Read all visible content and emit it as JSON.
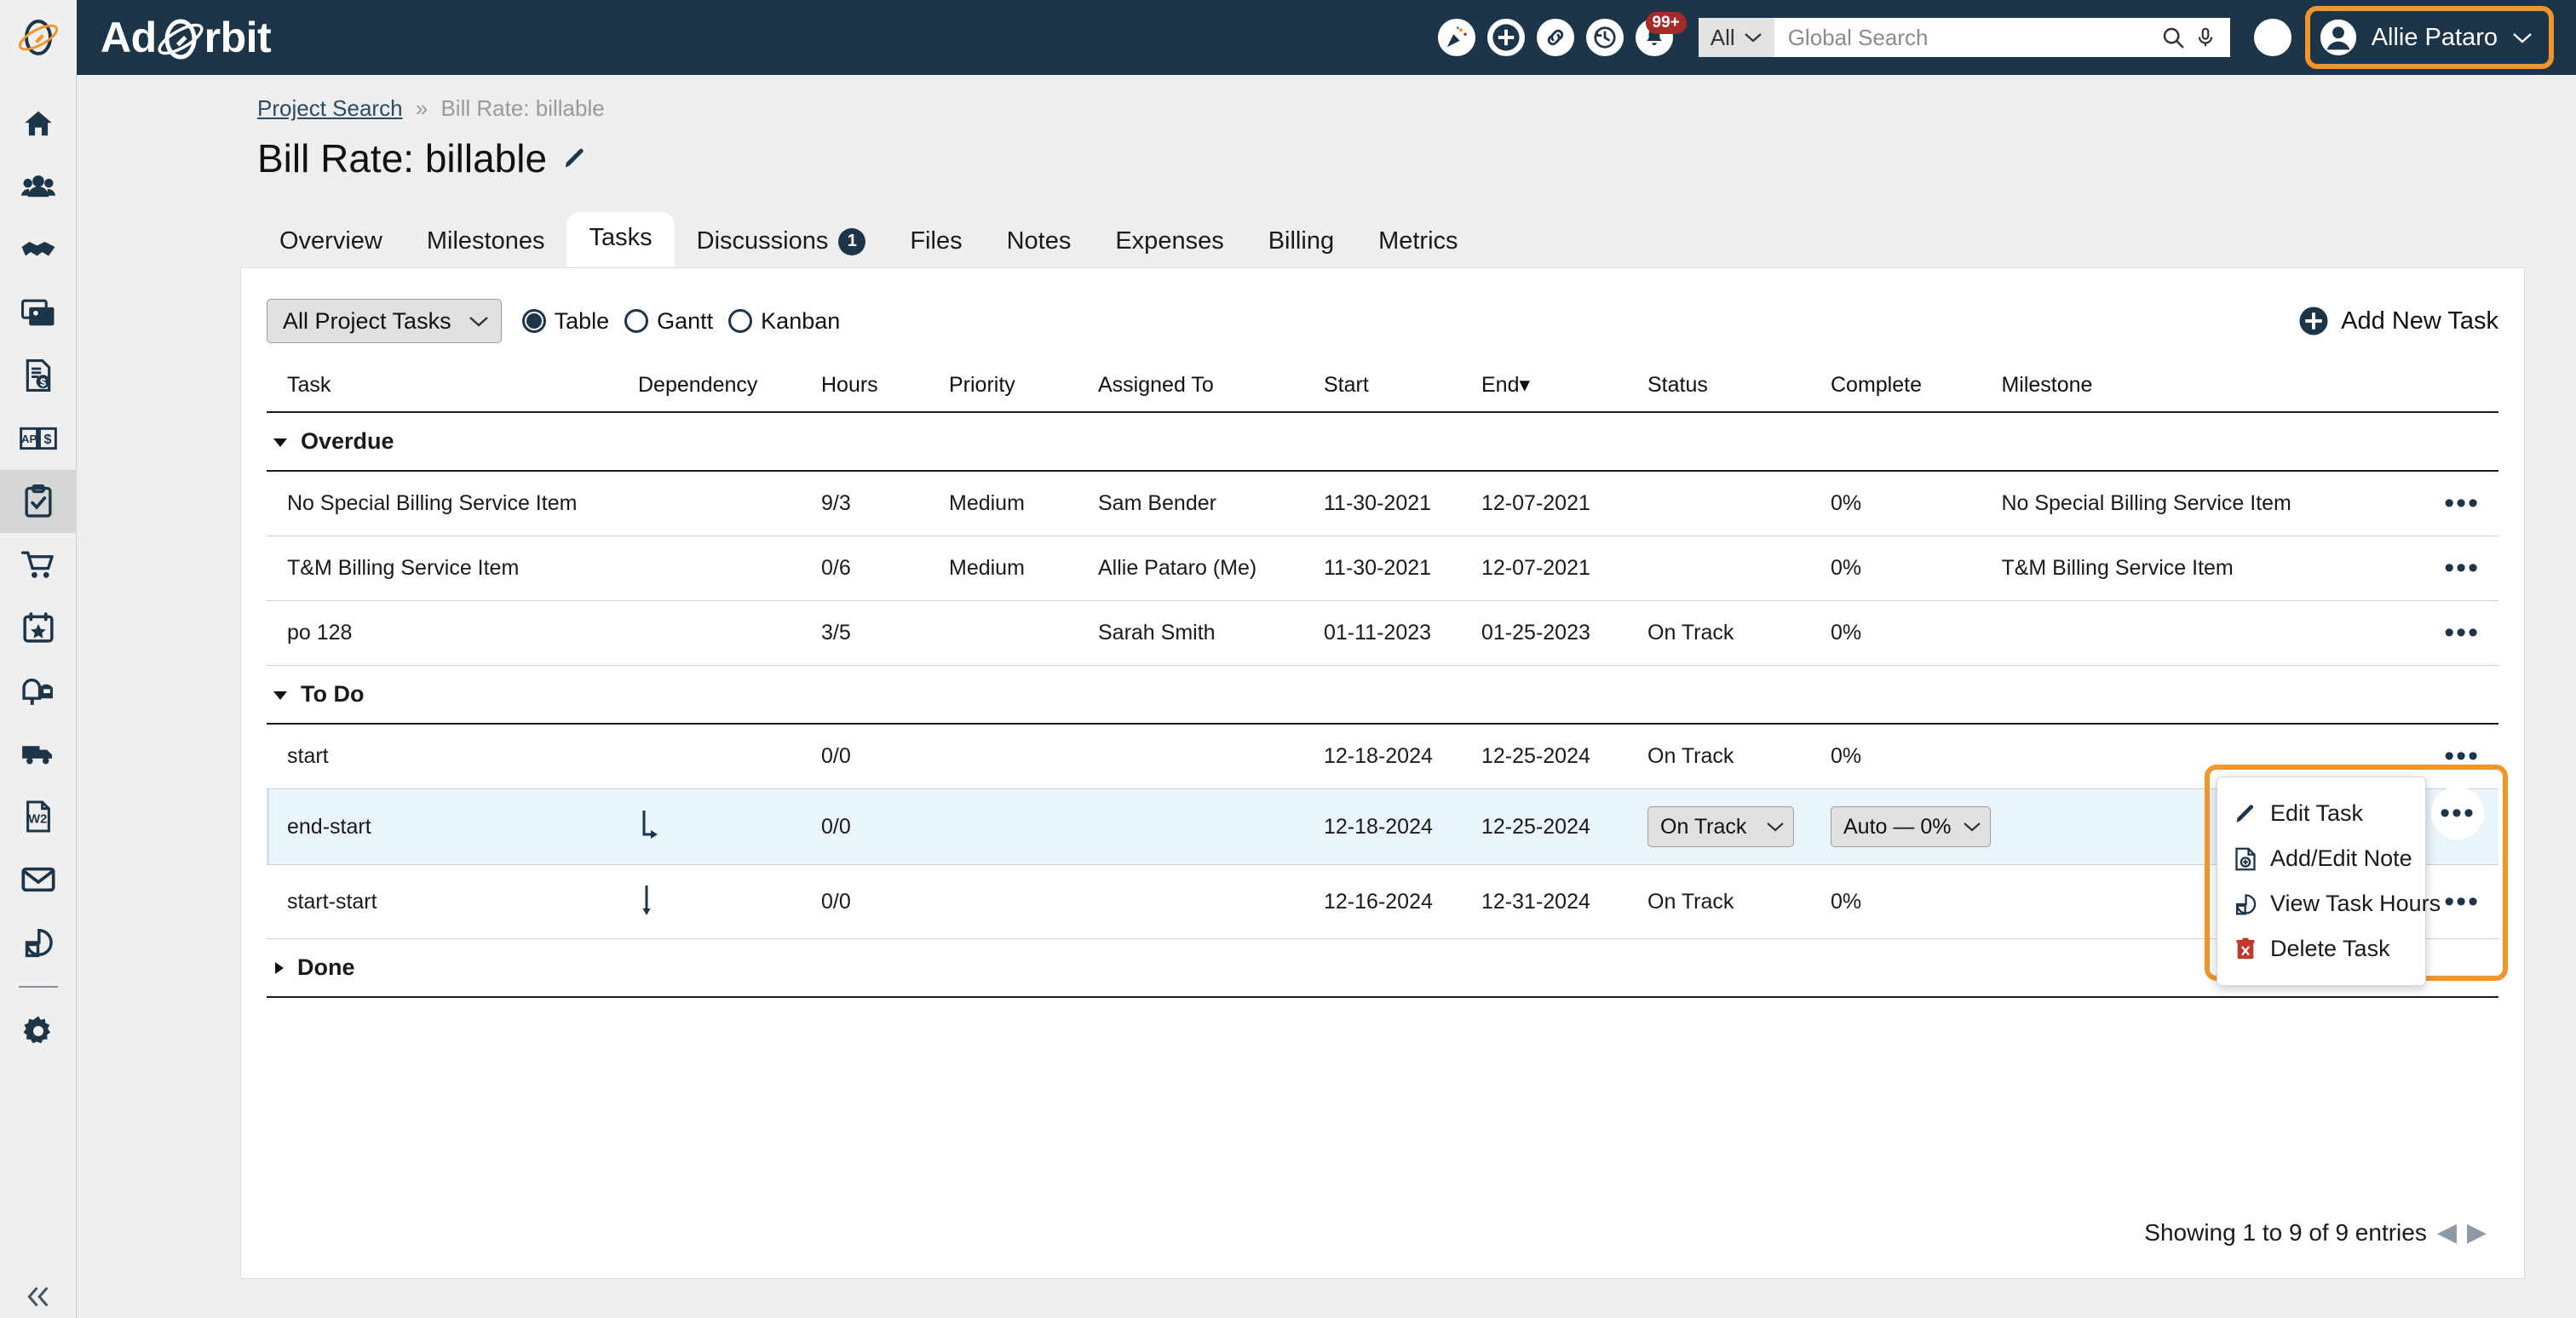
{
  "header": {
    "brand": "AdOrbit",
    "brand_parts": {
      "pre": "Ad",
      "post": "rbit"
    },
    "icons": [
      {
        "name": "celebration-icon",
        "glyph": "🎉"
      },
      {
        "name": "add-icon",
        "glyph": "+"
      },
      {
        "name": "link-icon",
        "glyph": "🔗"
      },
      {
        "name": "history-icon",
        "glyph": "↺"
      },
      {
        "name": "notifications-bell-icon",
        "glyph": "🔔"
      }
    ],
    "notification_badge": "99+",
    "search_scope": "All",
    "search_placeholder": "Global Search",
    "search_value": "",
    "help_label": "?",
    "user_name": "Allie Pataro",
    "accent_orange": "#f0962c",
    "navy": "#1d3549",
    "badge_red": "#a62a2a"
  },
  "sidebar": {
    "items": [
      {
        "name": "home",
        "label": "Home"
      },
      {
        "name": "people",
        "label": "People"
      },
      {
        "name": "partners",
        "label": "Partners"
      },
      {
        "name": "media",
        "label": "Media"
      },
      {
        "name": "invoices",
        "label": "Invoices"
      },
      {
        "name": "ap-ar",
        "label": "AP/AR"
      },
      {
        "name": "projects",
        "label": "Projects",
        "active": true
      },
      {
        "name": "orders",
        "label": "Orders"
      },
      {
        "name": "events",
        "label": "Events"
      },
      {
        "name": "mailbox",
        "label": "Mailbox"
      },
      {
        "name": "shipping",
        "label": "Shipping"
      },
      {
        "name": "w2",
        "label": "W2"
      },
      {
        "name": "email",
        "label": "Email"
      },
      {
        "name": "reports",
        "label": "Reports"
      },
      {
        "name": "settings",
        "label": "Settings"
      }
    ],
    "collapse_label": "Collapse"
  },
  "breadcrumb": {
    "root": "Project Search",
    "separator": "»",
    "current": "Bill Rate: billable"
  },
  "page": {
    "title": "Bill Rate: billable"
  },
  "tabs": [
    {
      "label": "Overview",
      "active": false
    },
    {
      "label": "Milestones",
      "active": false
    },
    {
      "label": "Tasks",
      "active": true
    },
    {
      "label": "Discussions",
      "badge": "1",
      "active": false
    },
    {
      "label": "Files",
      "active": false
    },
    {
      "label": "Notes",
      "active": false
    },
    {
      "label": "Expenses",
      "active": false
    },
    {
      "label": "Billing",
      "active": false
    },
    {
      "label": "Metrics",
      "active": false
    }
  ],
  "toolbar": {
    "filter_value": "All Project Tasks",
    "views": [
      {
        "label": "Table",
        "selected": true
      },
      {
        "label": "Gantt",
        "selected": false
      },
      {
        "label": "Kanban",
        "selected": false
      }
    ],
    "add_task_label": "Add New Task"
  },
  "table": {
    "columns": [
      "Task",
      "Dependency",
      "Hours",
      "Priority",
      "Assigned To",
      "Start",
      "End",
      "Status",
      "Complete",
      "Milestone"
    ],
    "sorted_column": "End",
    "sort_indicator": "▾",
    "groups": [
      {
        "label": "Overdue",
        "expanded": true,
        "rows": [
          {
            "task": "No Special Billing Service Item",
            "dependency": "",
            "hours": "9/3",
            "priority": "Medium",
            "assigned_to": "Sam Bender",
            "start": "11-30-2021",
            "end": "12-07-2021",
            "status": "",
            "complete": "0%",
            "milestone": "No Special Billing Service Item"
          },
          {
            "task": "T&M Billing Service Item",
            "dependency": "",
            "hours": "0/6",
            "priority": "Medium",
            "assigned_to": "Allie Pataro (Me)",
            "start": "11-30-2021",
            "end": "12-07-2021",
            "status": "",
            "complete": "0%",
            "milestone": "T&M Billing Service Item"
          },
          {
            "task": "po 128",
            "dependency": "",
            "hours": "3/5",
            "priority": "",
            "assigned_to": "Sarah Smith",
            "start": "01-11-2023",
            "end": "01-25-2023",
            "status": "On Track",
            "complete": "0%",
            "milestone": ""
          }
        ]
      },
      {
        "label": "To Do",
        "expanded": true,
        "rows": [
          {
            "task": "start",
            "dependency": "",
            "hours": "0/0",
            "priority": "",
            "assigned_to": "",
            "start": "12-18-2024",
            "end": "12-25-2024",
            "status": "On Track",
            "complete": "0%",
            "milestone": ""
          },
          {
            "task": "end-start",
            "dependency": "end-start-arrow",
            "hours": "0/0",
            "priority": "",
            "assigned_to": "",
            "start": "12-18-2024",
            "end": "12-25-2024",
            "status_select": "On Track",
            "complete_select": "Auto — 0%",
            "milestone": "",
            "highlighted": true
          },
          {
            "task": "start-start",
            "dependency": "start-start-arrow",
            "hours": "0/0",
            "priority": "",
            "assigned_to": "",
            "start": "12-16-2024",
            "end": "12-31-2024",
            "status": "On Track",
            "complete": "0%",
            "milestone": ""
          }
        ]
      },
      {
        "label": "Done",
        "expanded": false,
        "rows": []
      }
    ]
  },
  "context_menu": {
    "items": [
      {
        "label": "Edit Task",
        "icon": "pencil-icon"
      },
      {
        "label": "Add/Edit Note",
        "icon": "note-add-icon"
      },
      {
        "label": "View Task Hours",
        "icon": "pie-chart-icon"
      },
      {
        "label": "Delete Task",
        "icon": "trash-icon"
      }
    ]
  },
  "footer": {
    "entries_text": "Showing 1 to 9 of 9 entries",
    "prev_label": "◀",
    "next_label": "▶"
  }
}
